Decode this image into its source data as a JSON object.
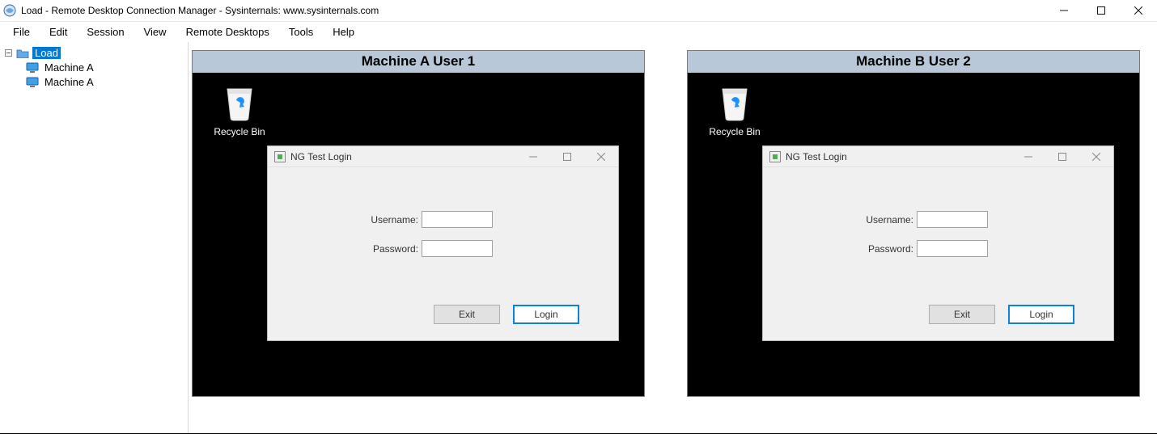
{
  "window": {
    "title": "Load - Remote Desktop Connection Manager - Sysinternals: www.sysinternals.com"
  },
  "menu": {
    "items": [
      "File",
      "Edit",
      "Session",
      "View",
      "Remote Desktops",
      "Tools",
      "Help"
    ]
  },
  "tree": {
    "root_label": "Load",
    "children": [
      "Machine A",
      "Machine A"
    ]
  },
  "desktops": [
    {
      "title": "Machine A User 1",
      "recycle_label": "Recycle Bin",
      "login": {
        "dialog_title": "NG Test Login",
        "username_label": "Username:",
        "password_label": "Password:",
        "exit_label": "Exit",
        "login_label": "Login"
      }
    },
    {
      "title": "Machine B User 2",
      "recycle_label": "Recycle Bin",
      "login": {
        "dialog_title": "NG Test Login",
        "username_label": "Username:",
        "password_label": "Password:",
        "exit_label": "Exit",
        "login_label": "Login"
      }
    }
  ]
}
